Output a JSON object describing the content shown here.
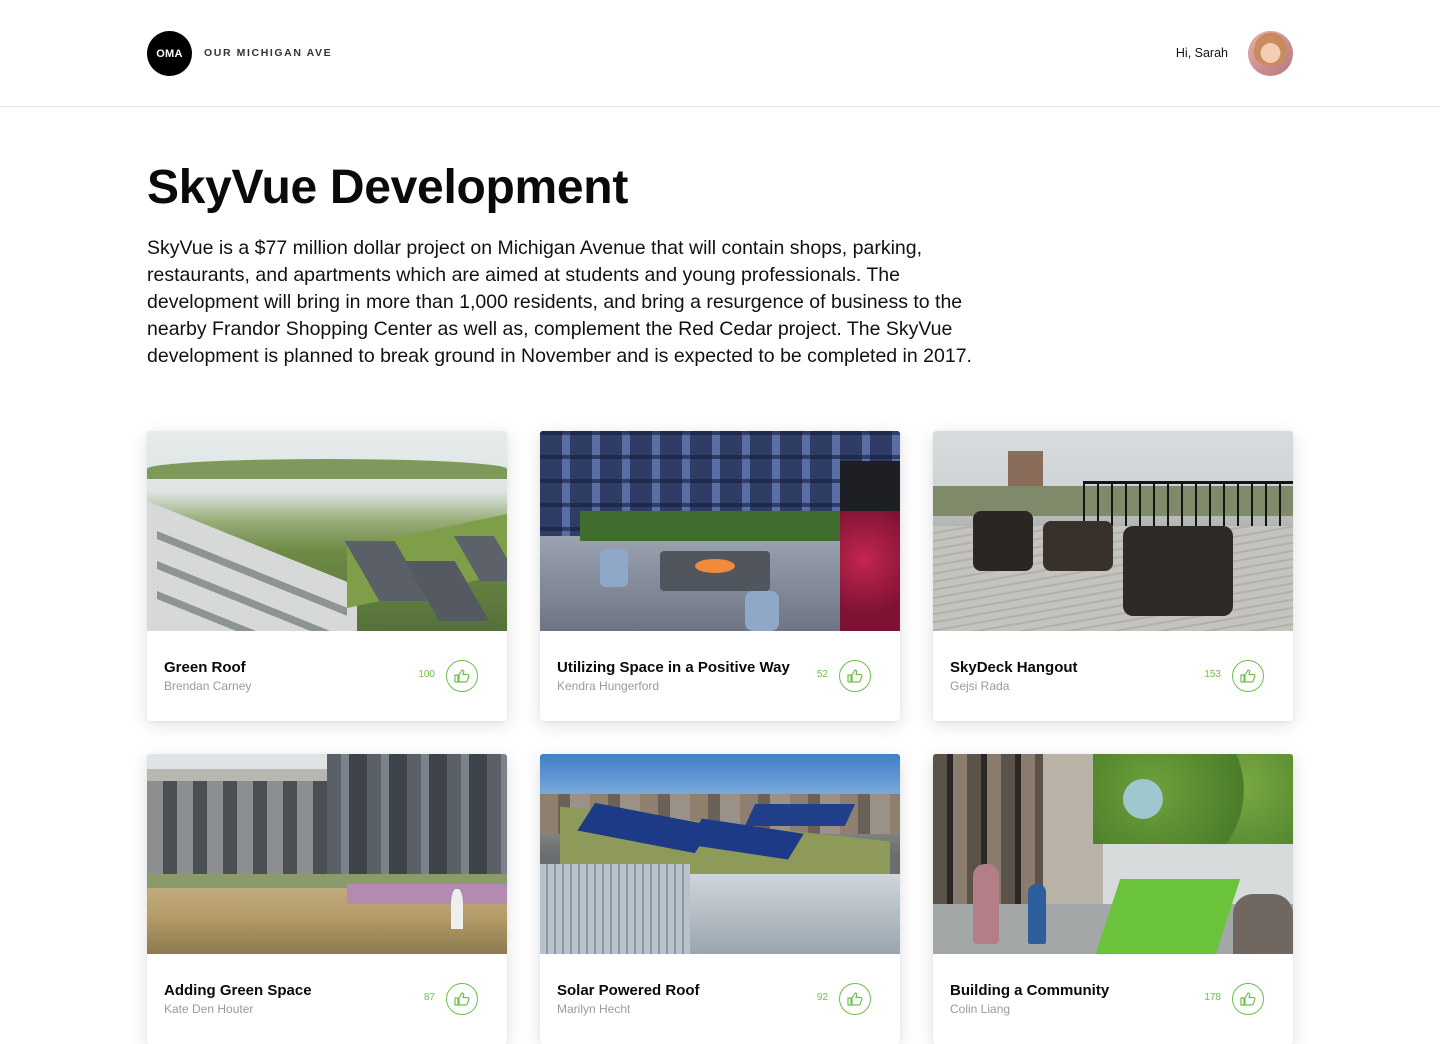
{
  "header": {
    "logo_text": "OMA",
    "brand": "OUR MICHIGAN AVE",
    "greeting": "Hi, Sarah"
  },
  "page": {
    "title": "SkyVue Development",
    "description": "SkyVue is a $77 million dollar project on Michigan Avenue that will contain shops, parking, restaurants, and apartments which are aimed at students and young professionals. The development will bring in more than 1,000 residents, and bring a resurgence of business to the nearby Frandor Shopping Center as well as, complement the Red Cedar project. The SkyVue development is planned to break ground in November and is expected to be completed in 2017."
  },
  "colors": {
    "accent_green": "#6cc04a",
    "text": "#0a0a0a",
    "muted": "#9a9a9a"
  },
  "cards": [
    {
      "title": "Green Roof",
      "author": "Brendan Carney",
      "count": "100",
      "image": "green-roof-photo",
      "icon": "thumbs-up-icon"
    },
    {
      "title": "Utilizing Space in a Positive Way",
      "author": "Kendra Hungerford",
      "count": "52",
      "image": "rooftop-lounge-photo",
      "icon": "thumbs-up-icon"
    },
    {
      "title": "SkyDeck Hangout",
      "author": "Gejsi Rada",
      "count": "153",
      "image": "sky-deck-photo",
      "icon": "thumbs-up-icon"
    },
    {
      "title": "Adding Green Space",
      "author": "Kate Den Houter",
      "count": "87",
      "image": "city-garden-photo",
      "icon": "thumbs-up-icon"
    },
    {
      "title": "Solar Powered Roof",
      "author": "Marilyn Hecht",
      "count": "92",
      "image": "solar-roof-photo",
      "icon": "thumbs-up-icon"
    },
    {
      "title": "Building a Community",
      "author": "Colin Liang",
      "count": "178",
      "image": "street-community-photo",
      "icon": "thumbs-up-icon"
    }
  ]
}
